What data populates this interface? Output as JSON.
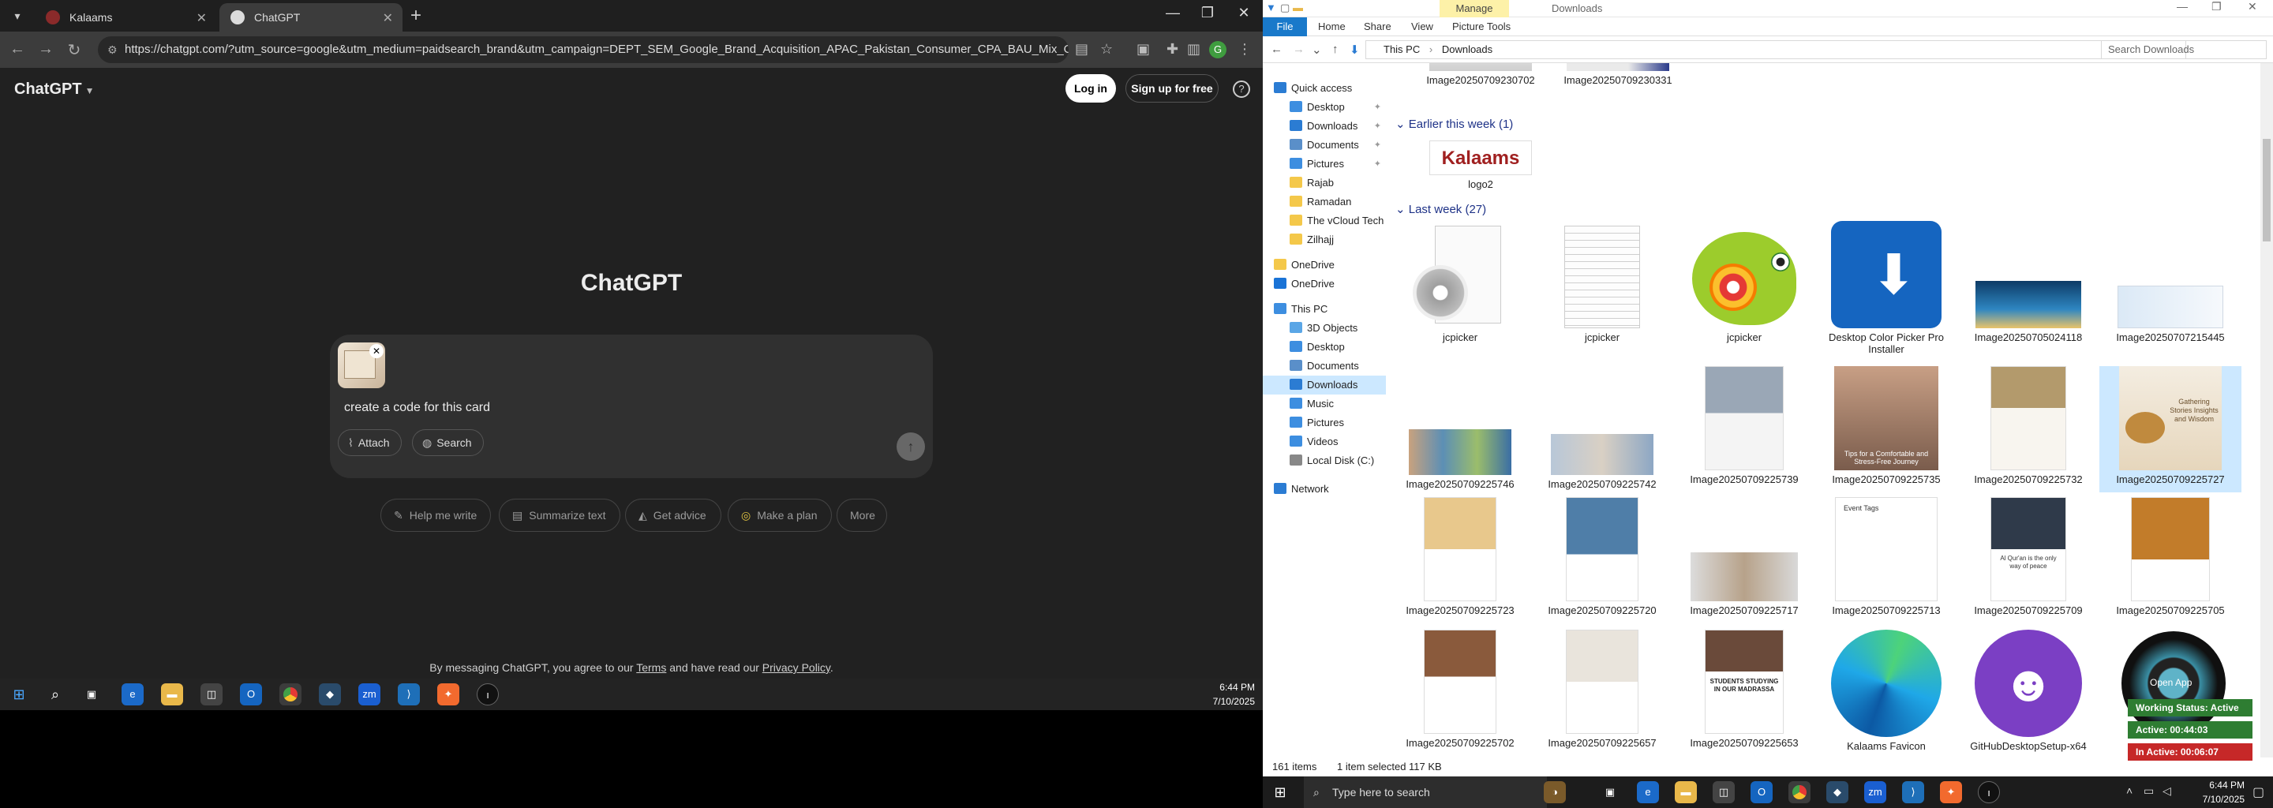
{
  "browser": {
    "tabs": [
      {
        "label": "Kalaams",
        "active": false
      },
      {
        "label": "ChatGPT",
        "active": true
      }
    ],
    "url": "https://chatgpt.com/?utm_source=google&utm_medium=paidsearch_brand&utm_campaign=DEPT_SEM_Google_Brand_Acquisition_APAC_Pakistan_Consumer_CPA_BAU_Mix_OfficialEnglish_Hi..."
  },
  "chatgpt": {
    "brand": "ChatGPT",
    "login_label": "Log in",
    "signup_label": "Sign up for free",
    "help_label": "?",
    "hero_title": "ChatGPT",
    "prompt_text": "create a code for this card",
    "attach_label": "Attach",
    "search_label": "Search",
    "chips": [
      "Help me write",
      "Summarize text",
      "Get advice",
      "Make a plan",
      "More"
    ],
    "disclaimer_pre": "By messaging ChatGPT, you agree to our ",
    "terms": "Terms",
    "disclaimer_mid": " and have read our ",
    "privacy": "Privacy Policy",
    "disclaimer_post": "."
  },
  "taskbar_left": {
    "time": "6:44 PM",
    "date": "7/10/2025"
  },
  "explorer": {
    "manage_tab": "Manage",
    "window_title": "Downloads",
    "ribbon": {
      "file": "File",
      "home": "Home",
      "share": "Share",
      "view": "View",
      "picture_tools": "Picture Tools"
    },
    "path": [
      "This PC",
      "Downloads"
    ],
    "search_placeholder": "Search Downloads",
    "nav": [
      {
        "label": "Quick access",
        "icon": "star-icon",
        "color": "#2b7cd3"
      },
      {
        "label": "Desktop",
        "icon": "desktop-icon",
        "color": "#3d8ee0",
        "pin": true
      },
      {
        "label": "Downloads",
        "icon": "download-icon",
        "color": "#2b7cd3",
        "pin": true
      },
      {
        "label": "Documents",
        "icon": "documents-icon",
        "color": "#5a8fc9",
        "pin": true
      },
      {
        "label": "Pictures",
        "icon": "pictures-icon",
        "color": "#3d8ee0",
        "pin": true
      },
      {
        "label": "Rajab",
        "icon": "folder-icon",
        "color": "#f4c84a"
      },
      {
        "label": "Ramadan",
        "icon": "folder-icon",
        "color": "#f4c84a"
      },
      {
        "label": "The vCloud Tech Bl",
        "icon": "folder-icon",
        "color": "#f4c84a"
      },
      {
        "label": "Zilhajj",
        "icon": "folder-icon",
        "color": "#f4c84a"
      },
      {
        "label": "OneDrive",
        "icon": "folder-icon",
        "color": "#f4c84a"
      },
      {
        "label": "OneDrive",
        "icon": "cloud-icon",
        "color": "#1a73d6"
      },
      {
        "label": "This PC",
        "icon": "pc-icon",
        "color": "#3d8ee0"
      },
      {
        "label": "3D Objects",
        "icon": "cube-icon",
        "color": "#5aa6e6"
      },
      {
        "label": "Desktop",
        "icon": "desktop-icon",
        "color": "#3d8ee0"
      },
      {
        "label": "Documents",
        "icon": "documents-icon",
        "color": "#5a8fc9"
      },
      {
        "label": "Downloads",
        "icon": "download-icon",
        "color": "#2b7cd3",
        "selected": true
      },
      {
        "label": "Music",
        "icon": "music-icon",
        "color": "#3d8ee0"
      },
      {
        "label": "Pictures",
        "icon": "pictures-icon",
        "color": "#3d8ee0"
      },
      {
        "label": "Videos",
        "icon": "video-icon",
        "color": "#3d8ee0"
      },
      {
        "label": "Local Disk (C:)",
        "icon": "disk-icon",
        "color": "#888888"
      },
      {
        "label": "Network",
        "icon": "network-icon",
        "color": "#2b7cd3"
      }
    ],
    "groups": {
      "earlier": "Earlier this week (1)",
      "last": "Last week (27)"
    },
    "top_items": [
      "Image20250709230702",
      "Image20250709230331"
    ],
    "logo_item": "logo2",
    "row1": [
      "jcpicker",
      "jcpicker",
      "jcpicker",
      "Desktop Color Picker Pro Installer",
      "Image20250705024118",
      "Image20250707215445"
    ],
    "row2": [
      "Image20250709225746",
      "Image20250709225742",
      "Image20250709225739",
      "Image20250709225735",
      "Image20250709225732",
      "Image20250709225727"
    ],
    "row3": [
      "Image20250709225723",
      "Image20250709225720",
      "Image20250709225717",
      "Image20250709225713",
      "Image20250709225709",
      "Image20250709225705"
    ],
    "row4": [
      "Image20250709225702",
      "Image20250709225657",
      "Image20250709225653",
      "Kalaams Favicon",
      "GitHubDesktopSetup-x64",
      ""
    ],
    "thumb_texts": {
      "logo": "Kalaams",
      "doc_event": "Event Tags",
      "doc_faith": "Al Qur'an is the only way of peace",
      "doc_students": "STUDENTS STUDYING IN OUR MADRASSA",
      "doc_comfort": "Tips for a Comfortable and Stress-Free Journey",
      "doc_gather": "Gathering Stories Insights and Wisdom"
    },
    "status": {
      "count": "161 items",
      "selected": "1 item selected  117 KB"
    }
  },
  "overlay": {
    "open_app": "Open App",
    "working_status": "Working Status: Active",
    "active": "Active: 00:44:03",
    "inactive": "In Active: 00:06:07"
  },
  "taskbar_right": {
    "search_placeholder": "Type here to search",
    "time": "6:44 PM",
    "date": "7/10/2025"
  }
}
